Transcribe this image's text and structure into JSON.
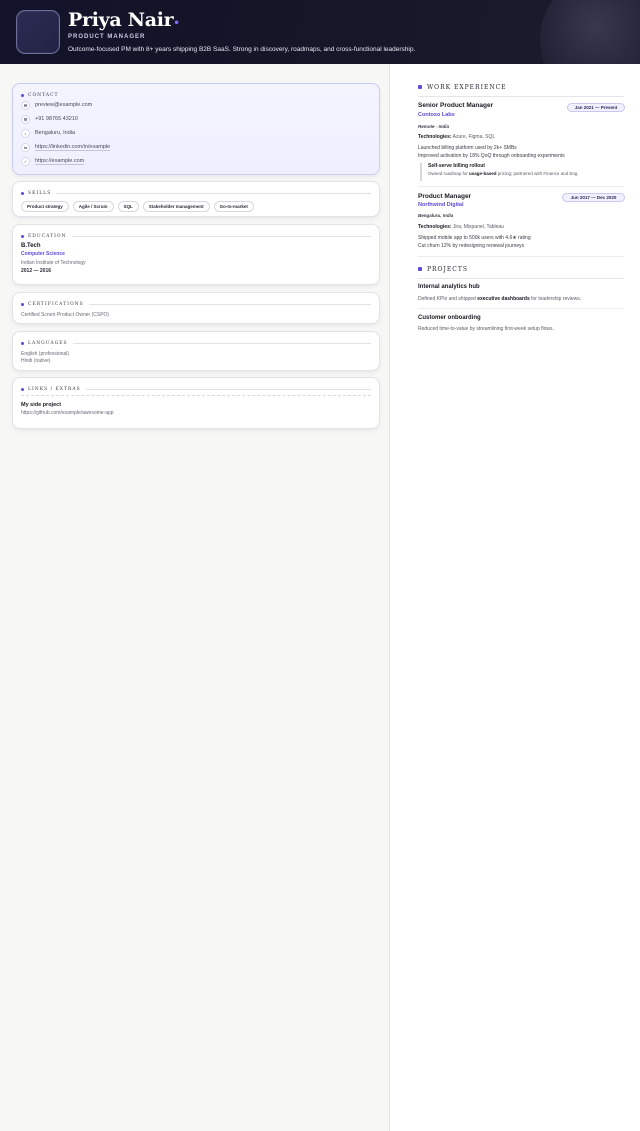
{
  "header": {
    "name": "Priya Nair",
    "name_dot": "•",
    "role": "PRODUCT MANAGER",
    "summary": "Outcome-focused PM with 8+ years shipping B2B SaaS. Strong in discovery, roadmaps, and cross-functional leadership."
  },
  "contact": {
    "title": "CONTACT",
    "items": [
      {
        "icon": "email-icon",
        "glyph": "✉",
        "text": "preview@example.com"
      },
      {
        "icon": "phone-icon",
        "glyph": "☰",
        "text": "+91 98765 43210"
      },
      {
        "icon": "location-icon",
        "glyph": "•",
        "text": "Bengaluru, India"
      },
      {
        "icon": "linkedin-icon",
        "glyph": "in",
        "text": "https://linkedin.com/in/example"
      },
      {
        "icon": "link-icon",
        "glyph": "⁄",
        "text": "https://example.com"
      }
    ]
  },
  "skills": {
    "title": "SKILLS",
    "items": [
      "Product strategy",
      "Agile / Scrum",
      "SQL",
      "Stakeholder management",
      "Go-to-market"
    ]
  },
  "education": {
    "title": "EDUCATION",
    "degree": "B.Tech",
    "field": "Computer Science",
    "school": "Indian Institute of Technology",
    "years": "2012 — 2016"
  },
  "certifications": {
    "title": "CERTIFICATIONS",
    "items": [
      "Certified Scrum Product Owner (CSPO)"
    ]
  },
  "languages": {
    "title": "LANGUAGES",
    "items": [
      "English (professional)",
      "Hindi (native)"
    ]
  },
  "links": {
    "title": "LINKS / EXTRAS",
    "item_title": "My side project",
    "item_url": "https://github.com/example/awesome-app"
  },
  "experience": {
    "title": "WORK EXPERIENCE",
    "jobs": [
      {
        "title": "Senior Product Manager",
        "company": "Contoso Labs",
        "location": "Remote · India",
        "dates": "Jan 2021 — Present",
        "tech_label": "Technologies:",
        "tech": " Azure, Figma, SQL",
        "bullets": [
          "Launched billing platform used by 2k+ SMBs",
          "Improved activation by 18% QoQ through onboarding experiments"
        ],
        "sub": {
          "title": "Self-serve billing rollout",
          "desc_pre": "Owned roadmap for ",
          "desc_bold": "usage-based",
          "desc_post": " pricing; partnered with Finance and Eng."
        }
      },
      {
        "title": "Product Manager",
        "company": "Northwind Digital",
        "location": "Bengaluru, India",
        "dates": "Jun 2017 — Dec 2020",
        "tech_label": "Technologies:",
        "tech": " Jira, Mixpanel, Tableau",
        "bullets": [
          "Shipped mobile app to 500k users with 4.6★ rating",
          "Cut churn 12% by redesigning renewal journeys"
        ]
      }
    ]
  },
  "projects": {
    "title": "PROJECTS",
    "items": [
      {
        "title": "Internal analytics hub",
        "desc_pre": "Defined KPIs and shipped ",
        "desc_bold": "executive dashboards",
        "desc_post": " for leadership reviews."
      },
      {
        "title": "Customer onboarding",
        "desc_pre": "Reduced time-to-value by streamlining first-week setup flows.",
        "desc_bold": "",
        "desc_post": ""
      }
    ]
  },
  "colors": {
    "accent": "#5b4bd6",
    "header_bg": "#14142a",
    "left_bg": "#f7f7f5"
  }
}
